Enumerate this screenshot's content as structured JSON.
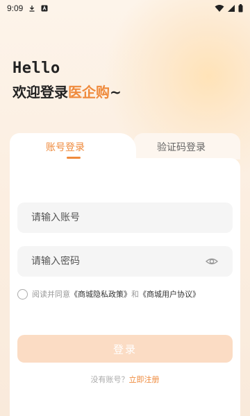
{
  "status_bar": {
    "time": "9:09",
    "icons": [
      "download-icon",
      "a-letter-icon",
      "wifi-icon",
      "signal-icon",
      "battery-icon"
    ]
  },
  "greeting": {
    "hello": "Hello",
    "welcome_prefix": "欢迎登录",
    "brand_name": "医企购",
    "welcome_suffix": "~"
  },
  "tabs": [
    {
      "label": "账号登录",
      "active": true
    },
    {
      "label": "验证码登录",
      "active": false
    }
  ],
  "form": {
    "account_placeholder": "请输入账号",
    "password_placeholder": "请输入密码",
    "password_visibility_icon": "eye-icon"
  },
  "agreement": {
    "prefix": "阅读并同意",
    "privacy_link": "《商城隐私政策》",
    "conjunction": "和",
    "user_agreement_link": "《商城用户协议》",
    "checked": false
  },
  "login_button": "登录",
  "register": {
    "prompt": "没有账号？",
    "link": "立即注册"
  },
  "colors": {
    "accent": "#ef8a3c",
    "button_disabled": "#fbdcc4",
    "background": "#fbf3ea"
  }
}
